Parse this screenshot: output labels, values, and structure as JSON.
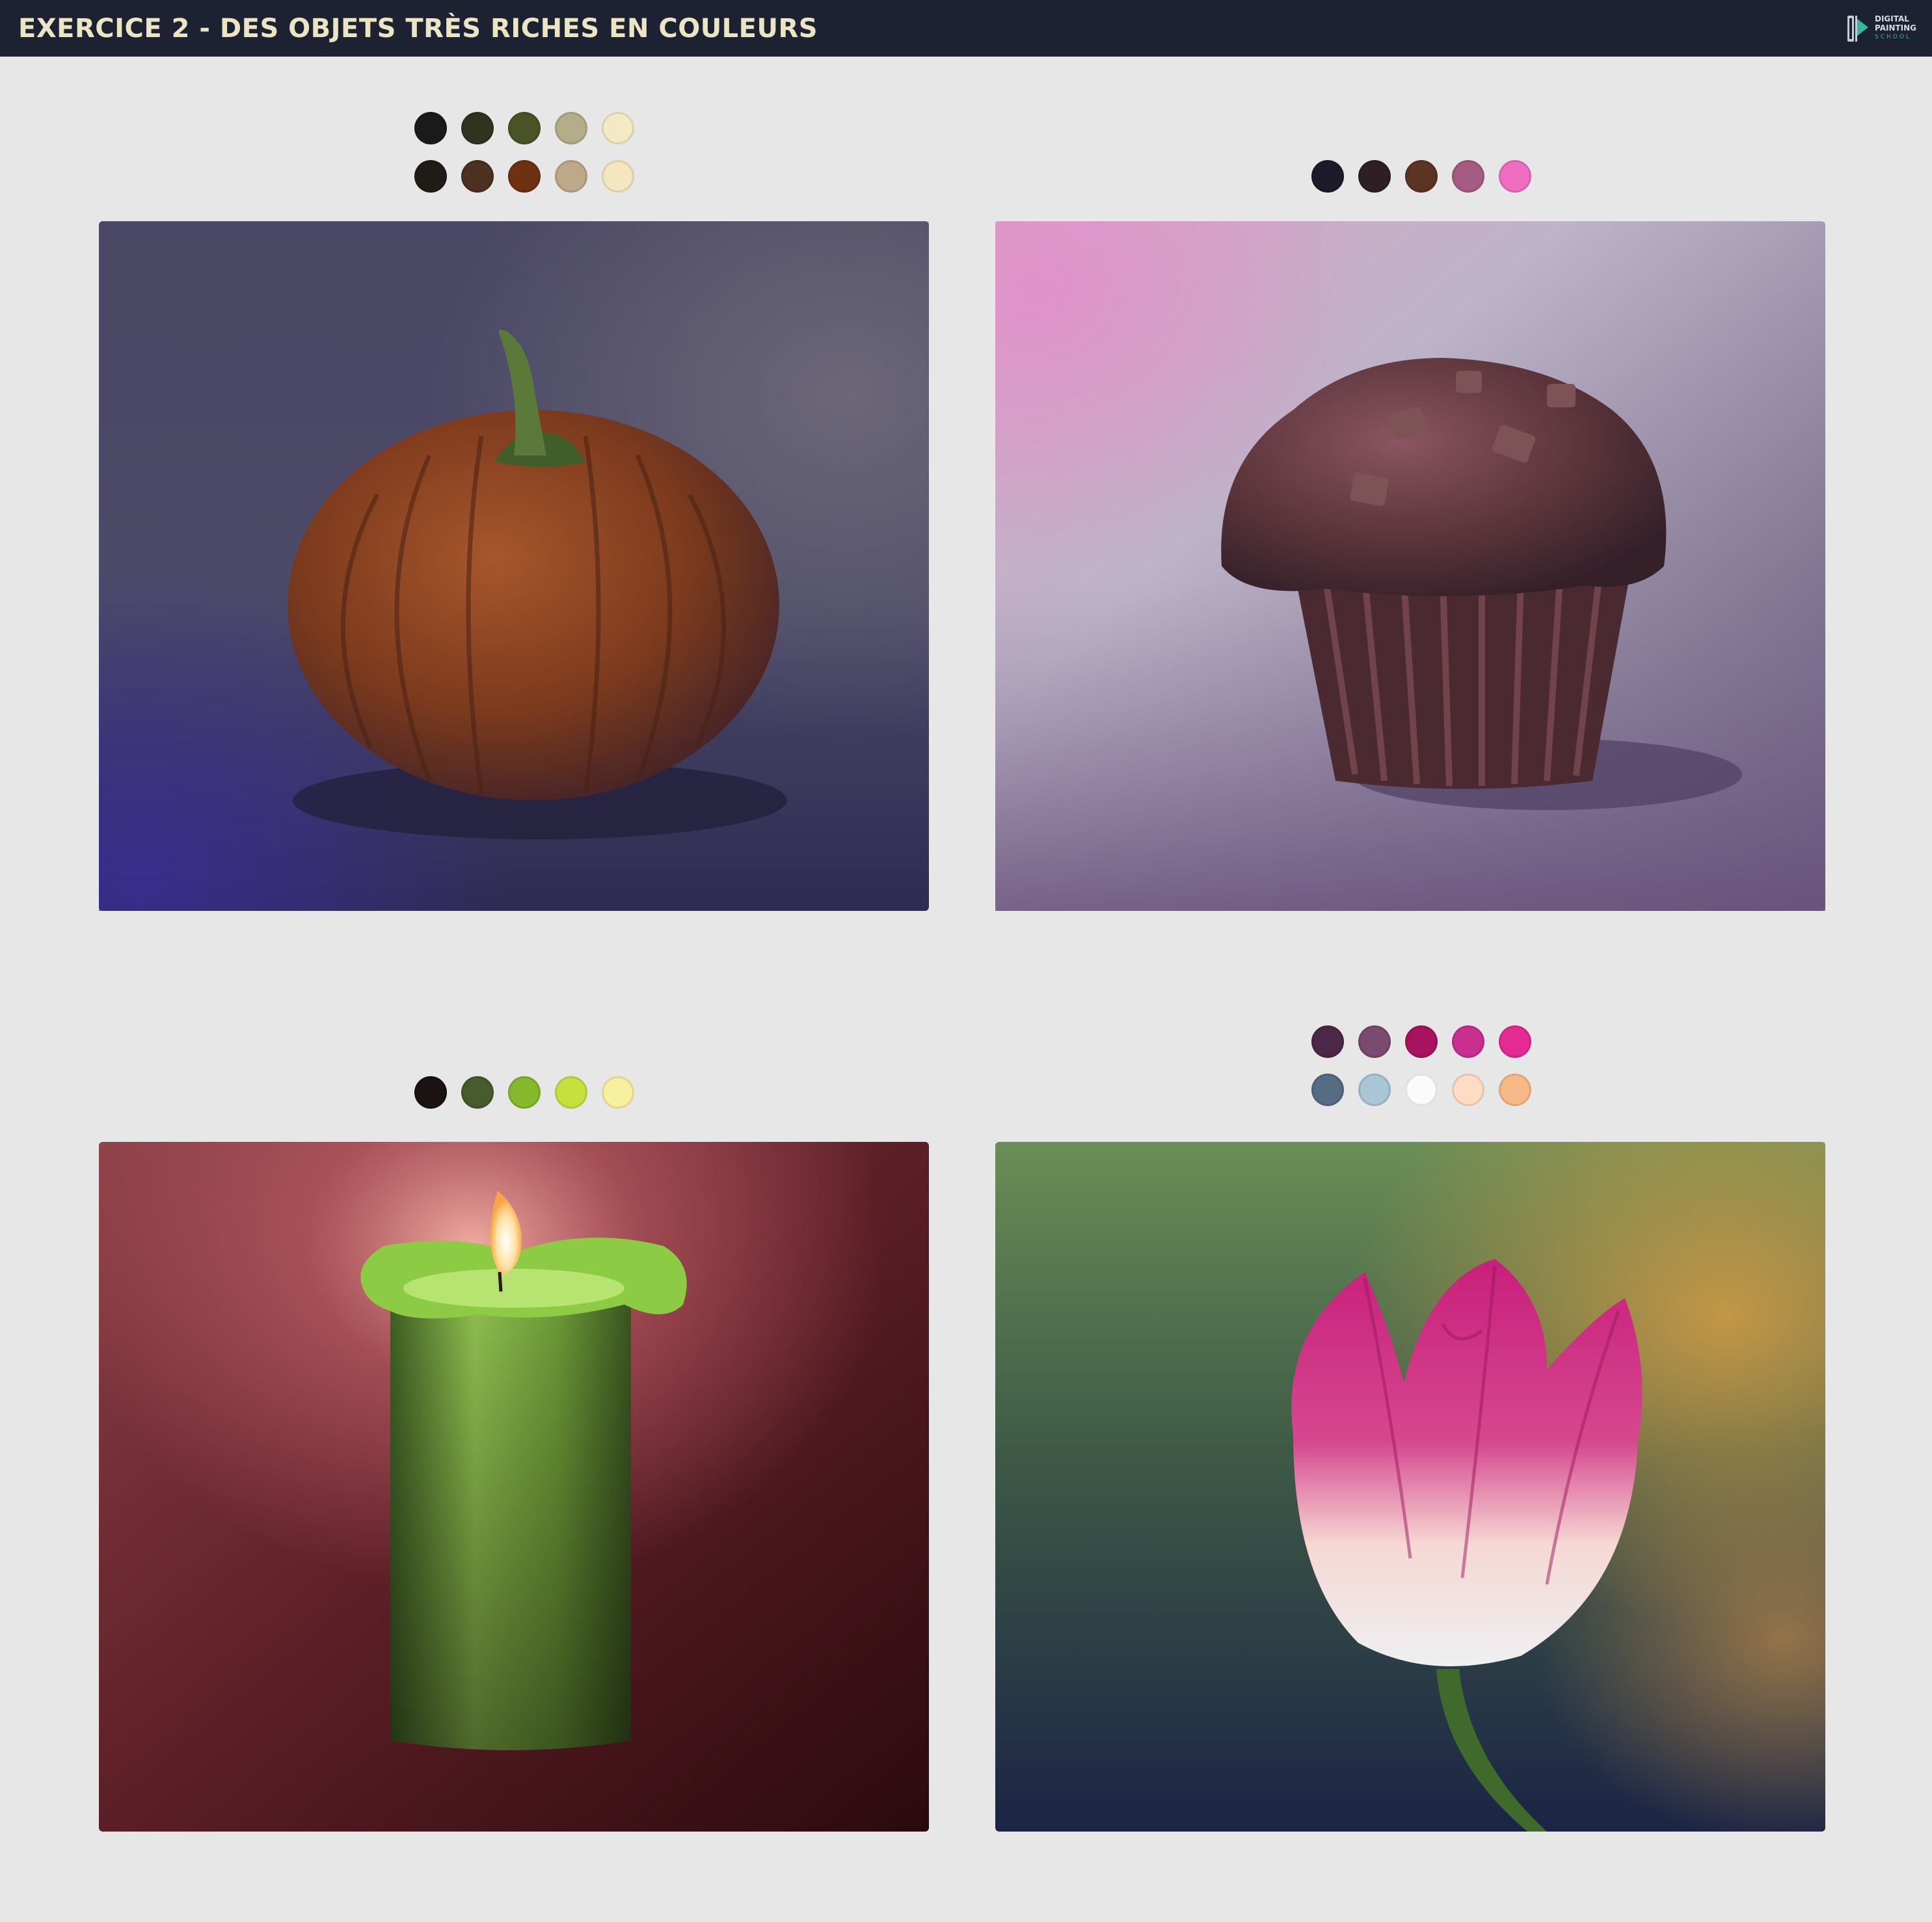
{
  "header": {
    "title": "EXERCICE 2 - DES OBJETS TRÈS RICHES EN COULEURS",
    "logo_lines": [
      "DIGITAL",
      "PAINTING",
      "SCHOOL"
    ]
  },
  "panels": [
    {
      "subject": "pumpkin",
      "palette_rows": [
        [
          "#1a1a1a",
          "#2f3420",
          "#4a5326",
          "#b4ad8a",
          "#f3e9c4"
        ],
        [
          "#211b16",
          "#4c3021",
          "#6e3112",
          "#bda98a",
          "#f4e6bf"
        ]
      ]
    },
    {
      "subject": "muffin",
      "palette_rows": [
        [
          "#1d1b2a",
          "#2e1f25",
          "#5c3424",
          "#a65c82",
          "#ef6ec2"
        ]
      ]
    },
    {
      "subject": "candle",
      "palette_rows": [
        [
          "#1b1212",
          "#485b2e",
          "#86b82c",
          "#c6e03e",
          "#f6f0a0"
        ]
      ]
    },
    {
      "subject": "tulip",
      "palette_rows": [
        [
          "#4c2748",
          "#7b4a6f",
          "#a8135f",
          "#c82f8e",
          "#e42a93"
        ],
        [
          "#566c82",
          "#a9c5d6",
          "#fbfbfb",
          "#fcdcc3",
          "#f7b987"
        ]
      ]
    }
  ]
}
